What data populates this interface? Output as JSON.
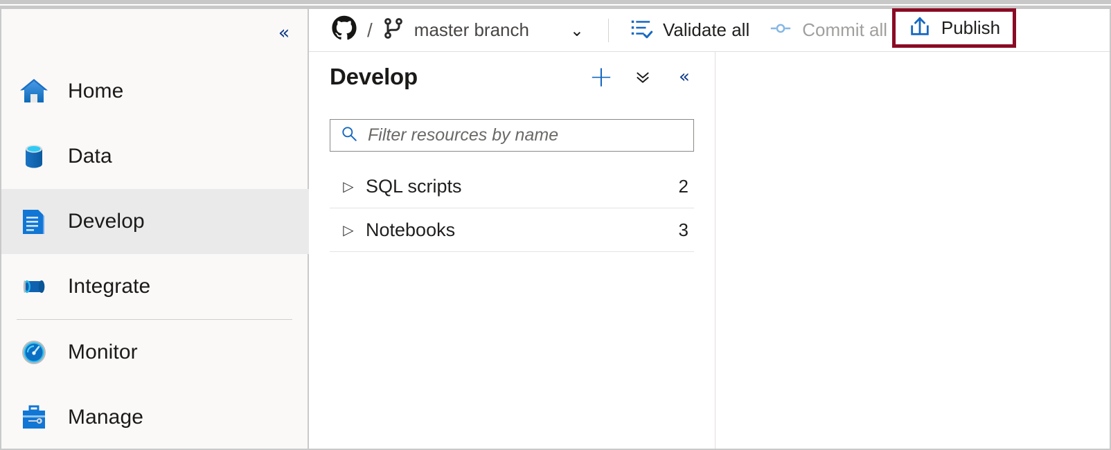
{
  "window": {
    "frame_color": "#c8c8c8"
  },
  "sidebar": {
    "collapse_icon": "chevron-double-left-icon",
    "items": [
      {
        "label": "Home",
        "icon": "home-icon",
        "active": false
      },
      {
        "label": "Data",
        "icon": "database-icon",
        "active": false
      },
      {
        "label": "Develop",
        "icon": "document-icon",
        "active": true
      },
      {
        "label": "Integrate",
        "icon": "pipeline-icon",
        "active": false
      },
      {
        "label": "Monitor",
        "icon": "gauge-icon",
        "active": false
      },
      {
        "label": "Manage",
        "icon": "toolbox-icon",
        "active": false
      }
    ]
  },
  "topbar": {
    "source_control_icon": "github-icon",
    "separator": "/",
    "branch_icon": "git-branch-icon",
    "branch_label": "master branch",
    "branch_caret_icon": "chevron-down-icon",
    "validate": {
      "label": "Validate all",
      "icon": "checklist-icon",
      "enabled": true
    },
    "commit": {
      "label": "Commit all",
      "icon": "git-commit-icon",
      "enabled": false
    },
    "publish": {
      "label": "Publish",
      "icon": "upload-icon",
      "enabled": true,
      "highlight_color": "#8a0b25"
    }
  },
  "panel": {
    "title": "Develop",
    "actions": [
      {
        "name": "add-new-resource",
        "icon": "plus-icon"
      },
      {
        "name": "collapse-all",
        "icon": "chevron-double-down-icon"
      },
      {
        "name": "hide-panel",
        "icon": "chevron-double-left-icon"
      }
    ],
    "search": {
      "placeholder": "Filter resources by name",
      "value": "",
      "icon": "search-icon"
    },
    "tree": [
      {
        "label": "SQL scripts",
        "count": "2",
        "expanded": false
      },
      {
        "label": "Notebooks",
        "count": "3",
        "expanded": false
      }
    ]
  },
  "accent": {
    "blue": "#1668c1",
    "active_bg": "#eaeaea",
    "muted_text": "#a19f9d"
  }
}
